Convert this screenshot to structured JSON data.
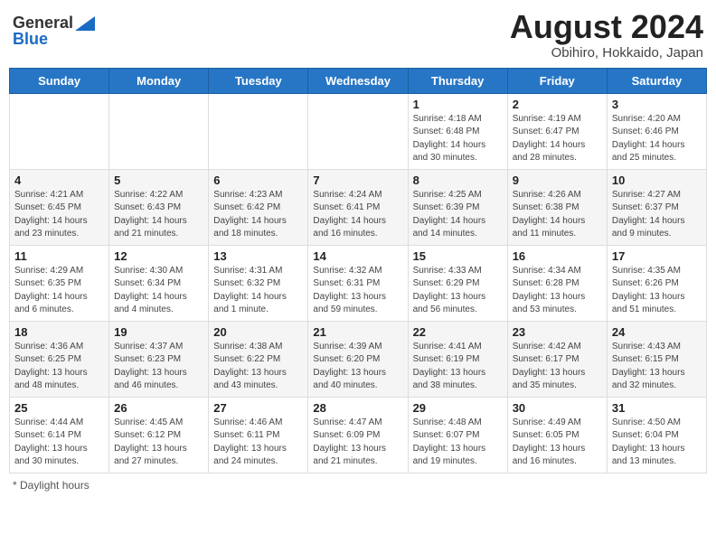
{
  "header": {
    "logo_general": "General",
    "logo_blue": "Blue",
    "title": "August 2024",
    "subtitle": "Obihiro, Hokkaido, Japan"
  },
  "weekdays": [
    "Sunday",
    "Monday",
    "Tuesday",
    "Wednesday",
    "Thursday",
    "Friday",
    "Saturday"
  ],
  "footer": {
    "daylight_label": "Daylight hours"
  },
  "weeks": [
    [
      {
        "day": "",
        "info": ""
      },
      {
        "day": "",
        "info": ""
      },
      {
        "day": "",
        "info": ""
      },
      {
        "day": "",
        "info": ""
      },
      {
        "day": "1",
        "info": "Sunrise: 4:18 AM\nSunset: 6:48 PM\nDaylight: 14 hours\nand 30 minutes."
      },
      {
        "day": "2",
        "info": "Sunrise: 4:19 AM\nSunset: 6:47 PM\nDaylight: 14 hours\nand 28 minutes."
      },
      {
        "day": "3",
        "info": "Sunrise: 4:20 AM\nSunset: 6:46 PM\nDaylight: 14 hours\nand 25 minutes."
      }
    ],
    [
      {
        "day": "4",
        "info": "Sunrise: 4:21 AM\nSunset: 6:45 PM\nDaylight: 14 hours\nand 23 minutes."
      },
      {
        "day": "5",
        "info": "Sunrise: 4:22 AM\nSunset: 6:43 PM\nDaylight: 14 hours\nand 21 minutes."
      },
      {
        "day": "6",
        "info": "Sunrise: 4:23 AM\nSunset: 6:42 PM\nDaylight: 14 hours\nand 18 minutes."
      },
      {
        "day": "7",
        "info": "Sunrise: 4:24 AM\nSunset: 6:41 PM\nDaylight: 14 hours\nand 16 minutes."
      },
      {
        "day": "8",
        "info": "Sunrise: 4:25 AM\nSunset: 6:39 PM\nDaylight: 14 hours\nand 14 minutes."
      },
      {
        "day": "9",
        "info": "Sunrise: 4:26 AM\nSunset: 6:38 PM\nDaylight: 14 hours\nand 11 minutes."
      },
      {
        "day": "10",
        "info": "Sunrise: 4:27 AM\nSunset: 6:37 PM\nDaylight: 14 hours\nand 9 minutes."
      }
    ],
    [
      {
        "day": "11",
        "info": "Sunrise: 4:29 AM\nSunset: 6:35 PM\nDaylight: 14 hours\nand 6 minutes."
      },
      {
        "day": "12",
        "info": "Sunrise: 4:30 AM\nSunset: 6:34 PM\nDaylight: 14 hours\nand 4 minutes."
      },
      {
        "day": "13",
        "info": "Sunrise: 4:31 AM\nSunset: 6:32 PM\nDaylight: 14 hours\nand 1 minute."
      },
      {
        "day": "14",
        "info": "Sunrise: 4:32 AM\nSunset: 6:31 PM\nDaylight: 13 hours\nand 59 minutes."
      },
      {
        "day": "15",
        "info": "Sunrise: 4:33 AM\nSunset: 6:29 PM\nDaylight: 13 hours\nand 56 minutes."
      },
      {
        "day": "16",
        "info": "Sunrise: 4:34 AM\nSunset: 6:28 PM\nDaylight: 13 hours\nand 53 minutes."
      },
      {
        "day": "17",
        "info": "Sunrise: 4:35 AM\nSunset: 6:26 PM\nDaylight: 13 hours\nand 51 minutes."
      }
    ],
    [
      {
        "day": "18",
        "info": "Sunrise: 4:36 AM\nSunset: 6:25 PM\nDaylight: 13 hours\nand 48 minutes."
      },
      {
        "day": "19",
        "info": "Sunrise: 4:37 AM\nSunset: 6:23 PM\nDaylight: 13 hours\nand 46 minutes."
      },
      {
        "day": "20",
        "info": "Sunrise: 4:38 AM\nSunset: 6:22 PM\nDaylight: 13 hours\nand 43 minutes."
      },
      {
        "day": "21",
        "info": "Sunrise: 4:39 AM\nSunset: 6:20 PM\nDaylight: 13 hours\nand 40 minutes."
      },
      {
        "day": "22",
        "info": "Sunrise: 4:41 AM\nSunset: 6:19 PM\nDaylight: 13 hours\nand 38 minutes."
      },
      {
        "day": "23",
        "info": "Sunrise: 4:42 AM\nSunset: 6:17 PM\nDaylight: 13 hours\nand 35 minutes."
      },
      {
        "day": "24",
        "info": "Sunrise: 4:43 AM\nSunset: 6:15 PM\nDaylight: 13 hours\nand 32 minutes."
      }
    ],
    [
      {
        "day": "25",
        "info": "Sunrise: 4:44 AM\nSunset: 6:14 PM\nDaylight: 13 hours\nand 30 minutes."
      },
      {
        "day": "26",
        "info": "Sunrise: 4:45 AM\nSunset: 6:12 PM\nDaylight: 13 hours\nand 27 minutes."
      },
      {
        "day": "27",
        "info": "Sunrise: 4:46 AM\nSunset: 6:11 PM\nDaylight: 13 hours\nand 24 minutes."
      },
      {
        "day": "28",
        "info": "Sunrise: 4:47 AM\nSunset: 6:09 PM\nDaylight: 13 hours\nand 21 minutes."
      },
      {
        "day": "29",
        "info": "Sunrise: 4:48 AM\nSunset: 6:07 PM\nDaylight: 13 hours\nand 19 minutes."
      },
      {
        "day": "30",
        "info": "Sunrise: 4:49 AM\nSunset: 6:05 PM\nDaylight: 13 hours\nand 16 minutes."
      },
      {
        "day": "31",
        "info": "Sunrise: 4:50 AM\nSunset: 6:04 PM\nDaylight: 13 hours\nand 13 minutes."
      }
    ]
  ]
}
